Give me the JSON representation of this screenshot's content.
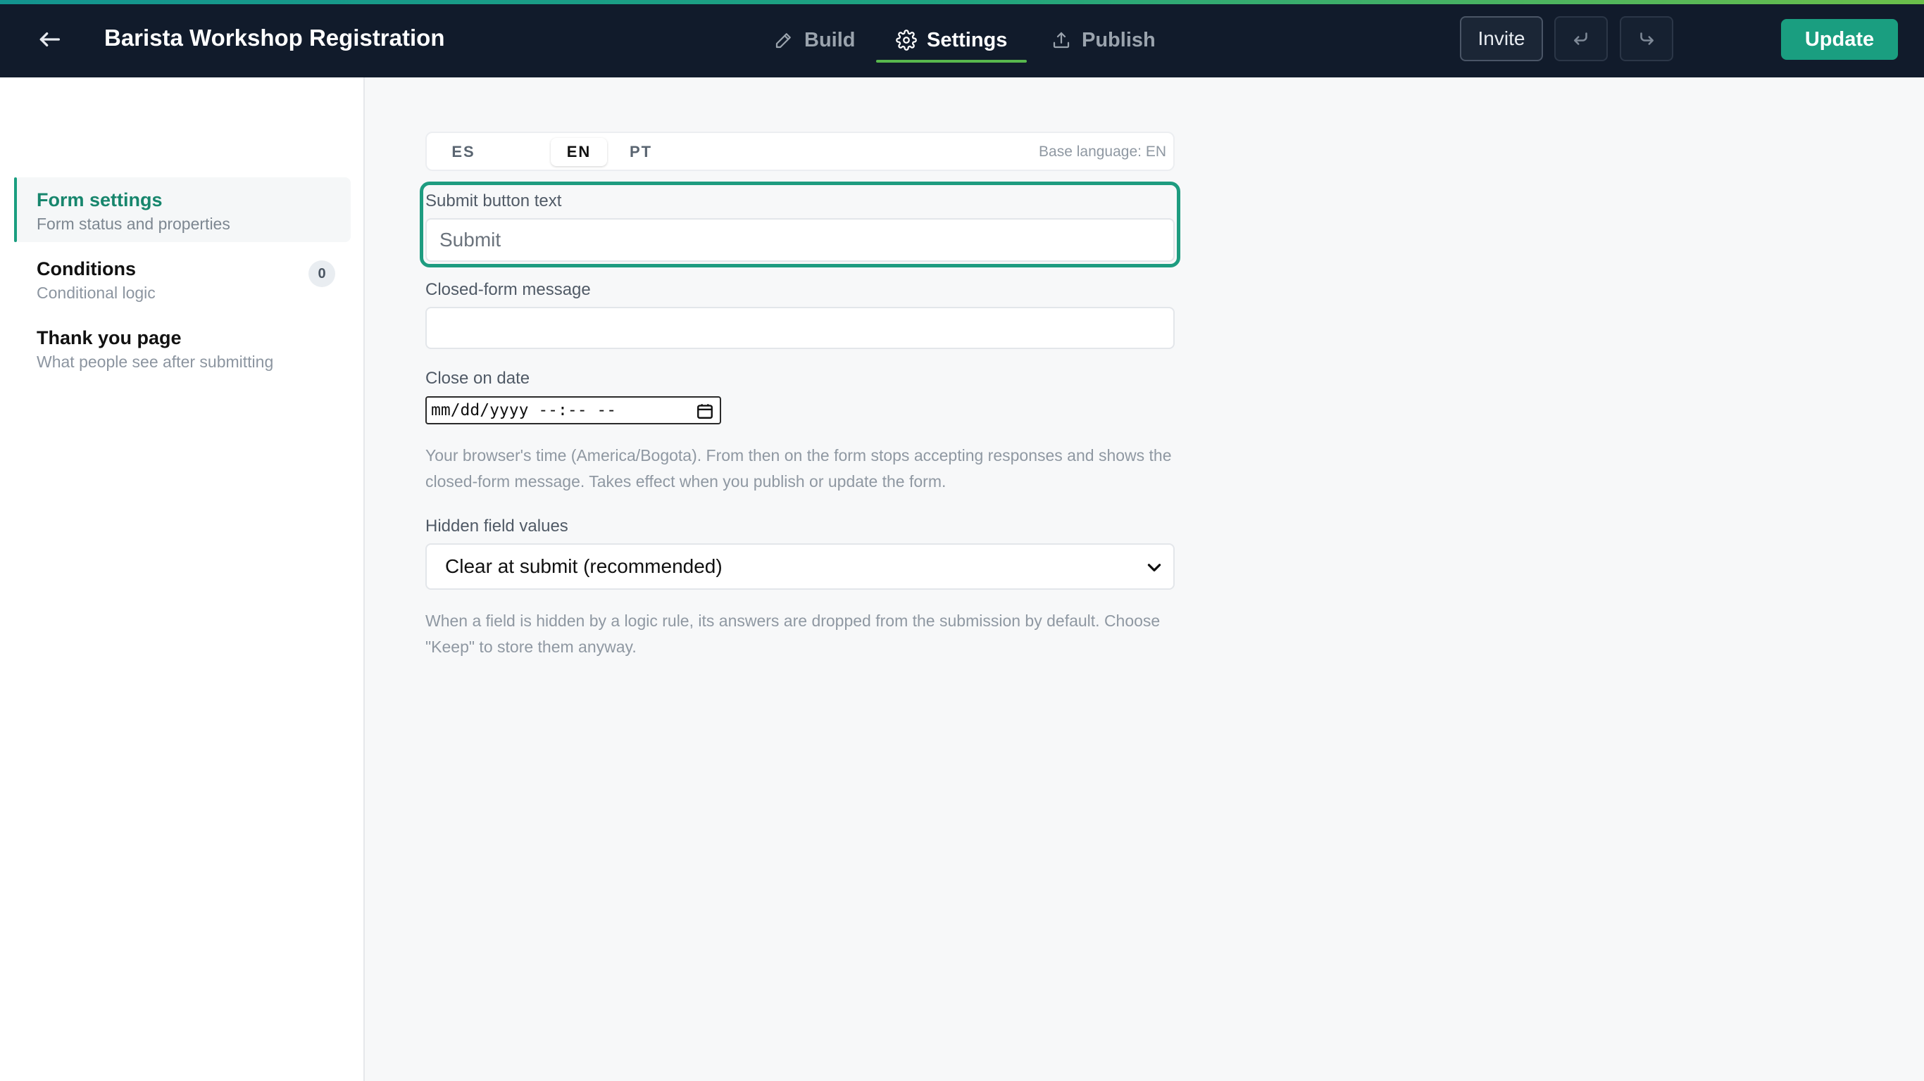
{
  "header": {
    "back_icon": "arrow-left-icon",
    "title": "Barista Workshop Registration",
    "tabs": [
      {
        "label": "Build",
        "icon": "pencil-icon",
        "active": false
      },
      {
        "label": "Settings",
        "icon": "gear-icon",
        "active": true
      },
      {
        "label": "Publish",
        "icon": "upload-icon",
        "active": false
      }
    ],
    "invite_label": "Invite",
    "undo_icon": "undo-icon",
    "redo_icon": "redo-icon",
    "update_label": "Update"
  },
  "sidebar": {
    "items": [
      {
        "title": "Form settings",
        "subtitle": "Form status and properties",
        "active": true
      },
      {
        "title": "Conditions",
        "subtitle": "Conditional logic",
        "badge": "0"
      },
      {
        "title": "Thank you page",
        "subtitle": "What people see after submitting"
      }
    ]
  },
  "settings": {
    "languages": [
      {
        "code": "ES",
        "active": false
      },
      {
        "code": "EN",
        "active": true
      },
      {
        "code": "PT",
        "active": false
      }
    ],
    "base_language": "Base language: EN",
    "submit_button": {
      "label": "Submit button text",
      "placeholder": "Submit",
      "value": ""
    },
    "closed_message": {
      "label": "Closed-form message",
      "placeholder": "",
      "value": ""
    },
    "close_on_date": {
      "label": "Close on date",
      "value": "mm/dd/yyyy --:-- --",
      "icon": "calendar-icon"
    },
    "close_on_date_help": "Your browser's time (America/Bogota). From then on the form stops accepting responses and shows the closed-form message. Takes effect when you publish or update the form.",
    "hidden_fields": {
      "label": "Hidden field values",
      "selected": "Clear at submit (recommended)",
      "icon": "chevron-down-icon"
    },
    "hidden_fields_help": "When a field is hidden by a logic rule, its answers are dropped from the submission by default. Choose \"Keep\" to store them anyway."
  },
  "colors": {
    "topbar": "#111b2b",
    "accent_green": "#1a9e80",
    "tab_underline": "#58b84d"
  }
}
